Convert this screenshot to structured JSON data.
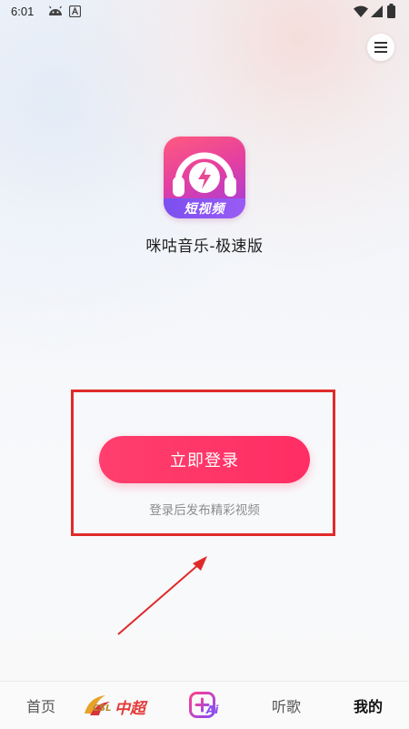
{
  "status_bar": {
    "time": "6:01",
    "icons": [
      "android-robot-icon",
      "a-badge-icon",
      "wifi-icon",
      "cellular-signal-icon",
      "battery-icon"
    ]
  },
  "header": {
    "menu_icon": "hamburger-menu-icon"
  },
  "app": {
    "logo_badge": "短视频",
    "name": "咪咕音乐-极速版"
  },
  "login": {
    "button_label": "立即登录",
    "hint": "登录后发布精彩视频"
  },
  "annotation": {
    "box_color": "#e02a2a",
    "arrow_color": "#e02a2a"
  },
  "bottom_nav": {
    "items": [
      {
        "label": "首页",
        "active": false
      },
      {
        "label": "中超",
        "sub_label": "CSL",
        "icon": "csl-logo-icon",
        "active": false
      },
      {
        "label": "Ai",
        "icon": "ai-create-icon",
        "active": false
      },
      {
        "label": "听歌",
        "active": false
      },
      {
        "label": "我的",
        "active": true
      }
    ]
  },
  "colors": {
    "accent": "#ff2d63",
    "hint_text": "#8d8d8d"
  }
}
